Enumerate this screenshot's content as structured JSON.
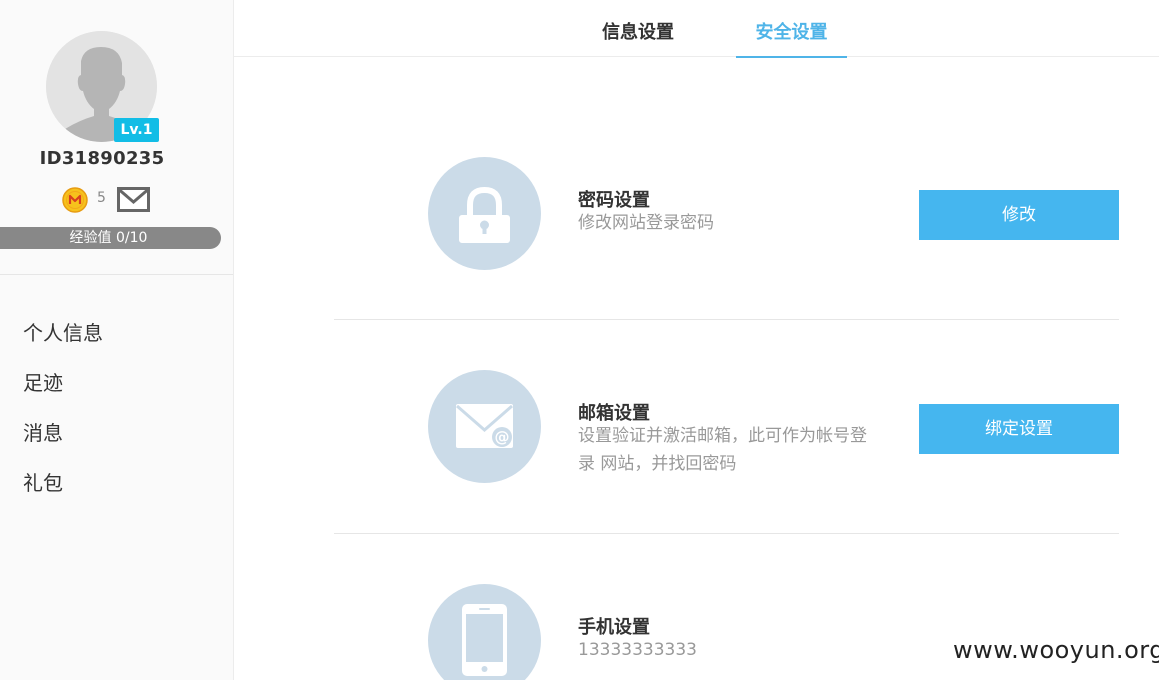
{
  "sidebar": {
    "level": "Lv.1",
    "user_id": "ID31890235",
    "coin_count": "5",
    "exp": "经验值 0/10",
    "nav": [
      {
        "label": "个人信息"
      },
      {
        "label": "足迹"
      },
      {
        "label": "消息"
      },
      {
        "label": "礼包"
      }
    ]
  },
  "tabs": {
    "info": "信息设置",
    "security": "安全设置",
    "active": "security"
  },
  "security_items": [
    {
      "title": "密码设置",
      "desc": "修改网站登录密码",
      "button": "修改",
      "icon": "lock-icon"
    },
    {
      "title": "邮箱设置",
      "desc": "设置验证并激活邮箱，此可作为帐号登录 网站，并找回密码",
      "button": "绑定设置",
      "icon": "envelope-icon"
    },
    {
      "title": "手机设置",
      "desc": "13333333333",
      "icon": "phone-icon"
    }
  ],
  "watermark": "www.wooyun.org",
  "colors": {
    "accent": "#45b6ef",
    "badge": "#12bde6",
    "icon_circle": "#cbdbe8",
    "exp_bar": "#888888"
  }
}
